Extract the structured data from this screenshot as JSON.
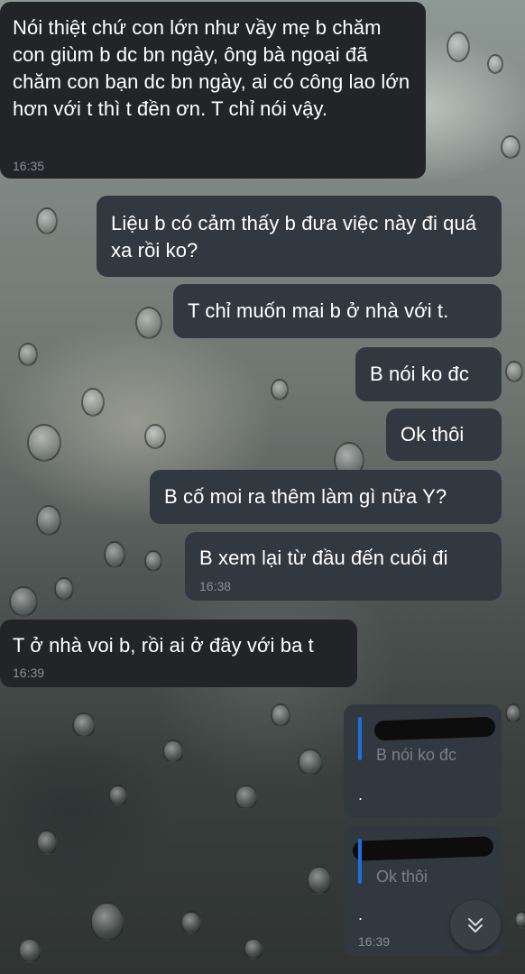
{
  "messages": [
    {
      "text": "Nói thiệt chứ con lớn như vầy mẹ b chăm con giùm b dc bn ngày, ông bà ngoại đã chăm con bạn dc bn ngày, ai có công lao lớn hơn với t thì t đền ơn. T chỉ nói vậy.",
      "time": "16:35"
    },
    {
      "text": "Liệu b có cảm thấy b đưa việc này đi quá xa rồi ko?"
    },
    {
      "text": "T chỉ muốn mai b ở nhà với t."
    },
    {
      "text": "B nói ko đc"
    },
    {
      "text": "Ok thôi"
    },
    {
      "text": "B cố moi ra thêm làm gì nữa Y?"
    },
    {
      "text": "B xem lại từ đầu đến cuối đi",
      "time": "16:38"
    },
    {
      "text": "T ở nhà voi b, rồi ai ở đây với ba t",
      "time": "16:39"
    },
    {
      "quote": "B nói ko đc",
      "text": "."
    },
    {
      "quote": "Ok thôi",
      "text": ".",
      "time": "16:39"
    }
  ],
  "scroll_button": {
    "icon": "double-chevron-down-icon"
  },
  "colors": {
    "incoming_bubble": "#222427",
    "outgoing_bubble": "#323840",
    "quote_bar": "#1e6fe0",
    "timestamp": "#8a8f96"
  }
}
